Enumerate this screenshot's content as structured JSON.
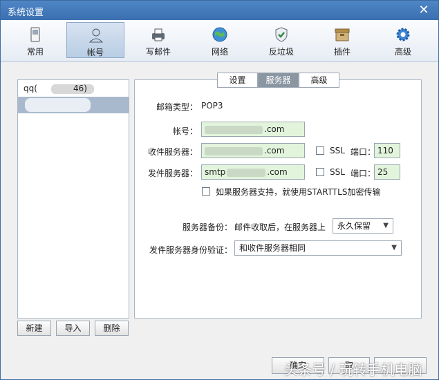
{
  "window": {
    "title": "系统设置"
  },
  "toolbar": {
    "items": [
      {
        "label": "常用",
        "icon": "phone-icon"
      },
      {
        "label": "帐号",
        "icon": "user-icon"
      },
      {
        "label": "写邮件",
        "icon": "printer-icon"
      },
      {
        "label": "网络",
        "icon": "globe-icon"
      },
      {
        "label": "反垃圾",
        "icon": "shield-icon"
      },
      {
        "label": "插件",
        "icon": "box-icon"
      },
      {
        "label": "高级",
        "icon": "gear-icon"
      }
    ],
    "active": "帐号"
  },
  "accounts": {
    "items": [
      {
        "prefix": "qq(",
        "suffix": "46)"
      }
    ],
    "buttons": {
      "new": "新建",
      "import": "导入",
      "delete": "删除"
    }
  },
  "subtabs": {
    "items": [
      {
        "label": "设置"
      },
      {
        "label": "服务器"
      },
      {
        "label": "高级"
      }
    ],
    "active": "服务器"
  },
  "server": {
    "mailbox_type_label": "邮箱类型：",
    "mailbox_type_value": "POP3",
    "account_label": "帐号：",
    "account_suffix": ".com",
    "incoming_label": "收件服务器：",
    "incoming_suffix": ".com",
    "outgoing_label": "发件服务器：",
    "outgoing_prefix": "smtp",
    "outgoing_suffix": ".com",
    "ssl_label": "SSL",
    "port_label": "端口：",
    "incoming_port": "110",
    "outgoing_port": "25",
    "starttls_label": "如果服务器支持，就使用STARTTLS加密传输",
    "backup_label": "服务器备份：",
    "backup_desc": "邮件收取后，在服务器上",
    "backup_value": "永久保留",
    "auth_label": "发件服务器身份验证：",
    "auth_value": "和收件服务器相同"
  },
  "footer": {
    "ok": "确定",
    "cancel": "取"
  },
  "watermark": "头条号 / 玩转手机电脑",
  "colors": {
    "title_bar": "#3a6fb0",
    "field_bg": "#e2f5dc",
    "selected": "#a9b9cd"
  }
}
